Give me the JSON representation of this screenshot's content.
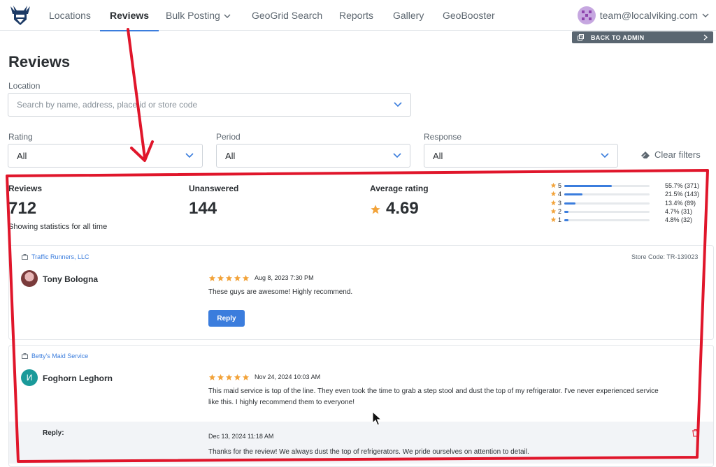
{
  "nav": {
    "tabs": [
      {
        "label": "Locations"
      },
      {
        "label": "Reviews"
      },
      {
        "label": "Bulk Posting"
      },
      {
        "label": "GeoGrid Search"
      },
      {
        "label": "Reports"
      },
      {
        "label": "Gallery"
      },
      {
        "label": "GeoBooster"
      }
    ],
    "account_email": "team@localviking.com",
    "back_to_admin": "BACK TO ADMIN"
  },
  "page": {
    "title": "Reviews"
  },
  "filters": {
    "location_label": "Location",
    "location_placeholder": "Search by name, address, place id or store code",
    "rating_label": "Rating",
    "rating_value": "All",
    "period_label": "Period",
    "period_value": "All",
    "response_label": "Response",
    "response_value": "All",
    "clear_label": "Clear filters"
  },
  "stats": {
    "reviews_label": "Reviews",
    "reviews_value": "712",
    "reviews_sub": "Showing statistics for all time",
    "unanswered_label": "Unanswered",
    "unanswered_value": "144",
    "avg_label": "Average rating",
    "avg_value": "4.69",
    "distribution": [
      {
        "stars": "5",
        "fraction": 0.557,
        "text": "55.7% (371)"
      },
      {
        "stars": "4",
        "fraction": 0.215,
        "text": "21.5% (143)"
      },
      {
        "stars": "3",
        "fraction": 0.134,
        "text": "13.4% (89)"
      },
      {
        "stars": "2",
        "fraction": 0.047,
        "text": "4.7% (31)"
      },
      {
        "stars": "1",
        "fraction": 0.048,
        "text": "4.8% (32)"
      }
    ]
  },
  "reviews": [
    {
      "location": "Traffic Runners, LLC",
      "store_code": "Store Code: TR-139023",
      "reviewer": "Tony Bologna",
      "stars": 5,
      "date": "Aug 8, 2023 7:30 PM",
      "text": "These guys are awesome! Highly recommend.",
      "reply_button": "Reply"
    },
    {
      "location": "Betty's Maid Service",
      "reviewer": "Foghorn Leghorn",
      "avatar_initial": "И",
      "stars": 5,
      "date": "Nov 24, 2024 10:03 AM",
      "text_line1": "This maid service is top of the line. They even took the time to grab a step stool and dust the top of my refrigerator. I've never experienced service",
      "text_line2": "like this. I highly recommend them to everyone!",
      "reply_label": "Reply:",
      "reply_date": "Dec 13, 2024 11:18 AM",
      "reply_text": "Thanks for the review! We always dust the top of refrigerators. We pride ourselves on attention to detail."
    }
  ],
  "colors": {
    "accent": "#3b7ddd",
    "star": "#f2a33a",
    "annotation": "#e0162b",
    "teal_avatar": "#1a9a9a"
  }
}
